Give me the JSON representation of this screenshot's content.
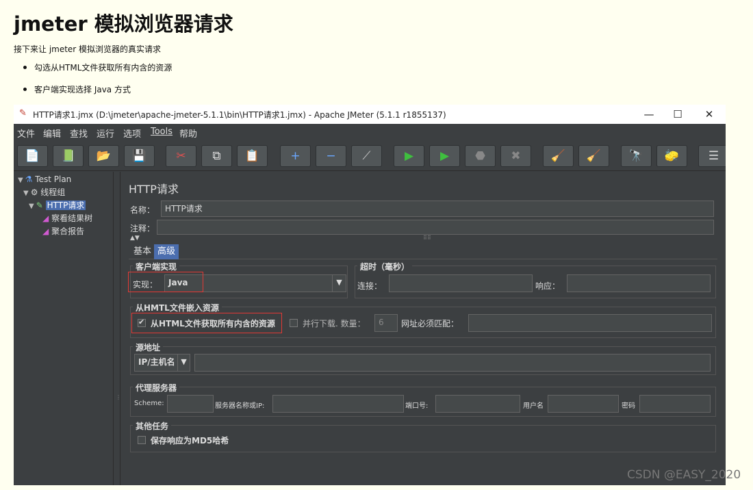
{
  "doc": {
    "title": "jmeter 模拟浏览器请求",
    "intro": "接下来让 jmeter 模拟浏览器的真实请求",
    "bullets": [
      "勾选从HTML文件获取所有内含的资源",
      "客户端实现选择 Java 方式"
    ]
  },
  "window": {
    "title": "HTTP请求1.jmx (D:\\jmeter\\apache-jmeter-5.1.1\\bin\\HTTP请求1.jmx) - Apache JMeter (5.1.1 r1855137)",
    "controls": {
      "minimize": "—",
      "maximize": "☐",
      "close": "✕"
    }
  },
  "menubar": [
    "文件",
    "编辑",
    "查找",
    "运行",
    "选项",
    "Tools",
    "帮助"
  ],
  "toolbar": [
    {
      "name": "new-icon",
      "glyph": "📄",
      "color": "#f5f5dc"
    },
    {
      "name": "templates-icon",
      "glyph": "📗",
      "color": "#6fbf6f"
    },
    {
      "name": "open-icon",
      "glyph": "📂",
      "color": "#f0b030"
    },
    {
      "name": "save-icon",
      "glyph": "💾",
      "color": "#ddd"
    },
    {
      "name": "cut-icon",
      "glyph": "✂",
      "color": "#e05050"
    },
    {
      "name": "copy-icon",
      "glyph": "⧉",
      "color": "#ddd"
    },
    {
      "name": "paste-icon",
      "glyph": "📋",
      "color": "#e0c080"
    },
    {
      "name": "expand-icon",
      "glyph": "+",
      "color": "#6aa7ff"
    },
    {
      "name": "collapse-icon",
      "glyph": "−",
      "color": "#6aa7ff"
    },
    {
      "name": "toggle-icon",
      "glyph": "⟋",
      "color": "#ccc"
    },
    {
      "name": "start-icon",
      "glyph": "▶",
      "color": "#3fbf3f"
    },
    {
      "name": "start-no-pause-icon",
      "glyph": "▶",
      "color": "#3fbf3f"
    },
    {
      "name": "stop-icon",
      "glyph": "⬣",
      "color": "#888"
    },
    {
      "name": "shutdown-icon",
      "glyph": "✖",
      "color": "#888"
    },
    {
      "name": "clear-icon",
      "glyph": "🧹",
      "color": "#e0c080"
    },
    {
      "name": "clear-all-icon",
      "glyph": "🧹",
      "color": "#e0c080"
    },
    {
      "name": "search-icon",
      "glyph": "🔭",
      "color": "#ddd"
    },
    {
      "name": "reset-search-icon",
      "glyph": "🧽",
      "color": "#f0c030"
    },
    {
      "name": "function-helper-icon",
      "glyph": "☰",
      "color": "#ddd"
    }
  ],
  "tree": {
    "test_plan": "Test Plan",
    "thread_group": "线程组",
    "http_request": "HTTP请求",
    "view_results_tree": "察看结果树",
    "aggregate_report": "聚合报告"
  },
  "panel": {
    "title": "HTTP请求",
    "name_label": "名称：",
    "name_value": "HTTP请求",
    "comment_label": "注释：",
    "tabs": [
      "基本",
      "高级"
    ],
    "client_impl": {
      "group_title": "客户端实现",
      "impl_label": "实现：",
      "impl_value": "Java"
    },
    "timeouts": {
      "group_title": "超时（毫秒）",
      "connect_label": "连接：",
      "response_label": "响应："
    },
    "embedded": {
      "group_title": "从HMTL文件嵌入资源",
      "retrieve_label": "从HTML文件获取所有内含的资源",
      "retrieve_checked": true,
      "parallel_label": "并行下载. 数量：",
      "parallel_value": "6",
      "url_match_label": "网址必须匹配："
    },
    "source": {
      "group_title": "源地址",
      "type_value": "IP/主机名"
    },
    "proxy": {
      "group_title": "代理服务器",
      "scheme_label": "Scheme:",
      "server_label": "服务器名称或IP:",
      "port_label": "端口号:",
      "user_label": "用户名",
      "password_label": "密码"
    },
    "other": {
      "group_title": "其他任务",
      "md5_label": "保存响应为MD5哈希"
    }
  },
  "watermark": "CSDN @EASY_2020"
}
